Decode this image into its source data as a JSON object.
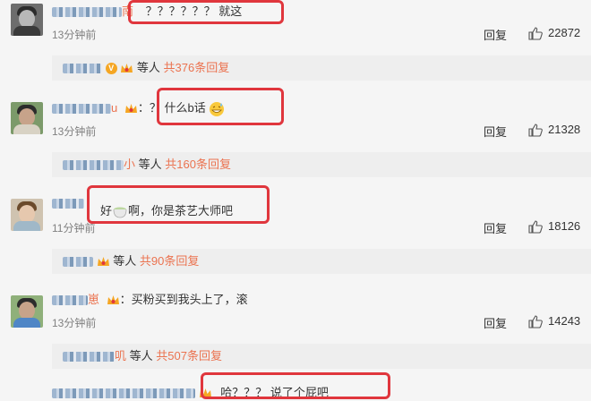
{
  "comments": [
    {
      "name_suffix": "南",
      "colon": "",
      "text": "？？？？？？ 就这",
      "time": "13分钟前",
      "reply_label": "回复",
      "likes": "22872",
      "replies": {
        "suffix": "等人",
        "more": "共376条回复"
      }
    },
    {
      "name_suffix": "u",
      "colon": "：",
      "text": "？ 什么b话",
      "emoji": "grinning-sweat-face",
      "time": "13分钟前",
      "reply_label": "回复",
      "likes": "21328",
      "replies": {
        "name_suffix": "小",
        "suffix": "等人",
        "more": "共160条回复"
      }
    },
    {
      "name_suffix": "",
      "colon": "",
      "text_pre": "好",
      "emoji": "tea-cup",
      "text": "啊，你是茶艺大师吧",
      "time": "11分钟前",
      "reply_label": "回复",
      "likes": "18126",
      "replies": {
        "suffix": "等人",
        "more": "共90条回复"
      }
    },
    {
      "name_suffix": "崽",
      "colon": "：",
      "text": "买粉买到我头上了，滚",
      "time": "13分钟前",
      "reply_label": "回复",
      "likes": "14243",
      "replies": {
        "name_suffix": "叽",
        "suffix": "等人",
        "more": "共507条回复"
      }
    },
    {
      "text": "哈？？？ 说了个屁吧"
    }
  ],
  "colors": {
    "name": "#eb7350",
    "highlight": "#e0363d",
    "background": "#f5f5f5"
  },
  "icons": {
    "like": "thumbs-up-icon",
    "member": "vip-crown-icon",
    "verified": "v-badge-icon"
  }
}
